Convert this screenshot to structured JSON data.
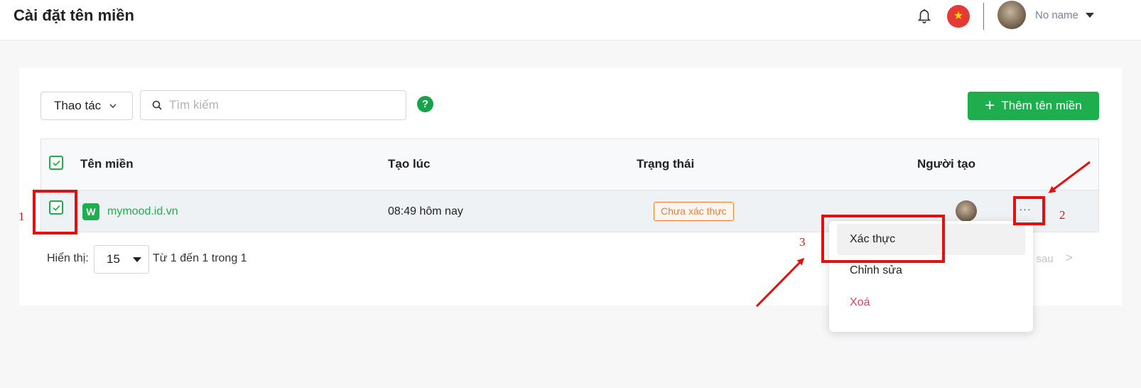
{
  "header": {
    "title": "Cài đặt tên miền",
    "flag_glyph": "★",
    "user_name": "No name"
  },
  "toolbar": {
    "actions_label": "Thao tác",
    "search_placeholder": "Tìm kiếm",
    "help_glyph": "?",
    "add_label": "Thêm tên miền",
    "add_glyph": "+"
  },
  "table": {
    "columns": [
      "Tên miền",
      "Tạo lúc",
      "Trạng thái",
      "Người tạo"
    ],
    "rows": [
      {
        "icon_letter": "W",
        "domain": "mymood.id.vn",
        "created": "08:49 hôm nay",
        "status": "Chưa xác thực",
        "more": "···"
      }
    ]
  },
  "pagination": {
    "show_label": "Hiển thị:",
    "page_size": "15",
    "range": "Từ 1 đến 1 trong 1",
    "next_partial": "g sau",
    "next_arrow": ">"
  },
  "row_menu": {
    "items": [
      "Xác thực",
      "Chỉnh sửa",
      "Xoá"
    ]
  },
  "annotations": {
    "labels": [
      "1",
      "2",
      "3"
    ]
  },
  "colors": {
    "brand_green": "#1fae4e",
    "status_orange": "#f07a3a",
    "danger": "#e0435b",
    "annotation_red": "#e31010"
  }
}
